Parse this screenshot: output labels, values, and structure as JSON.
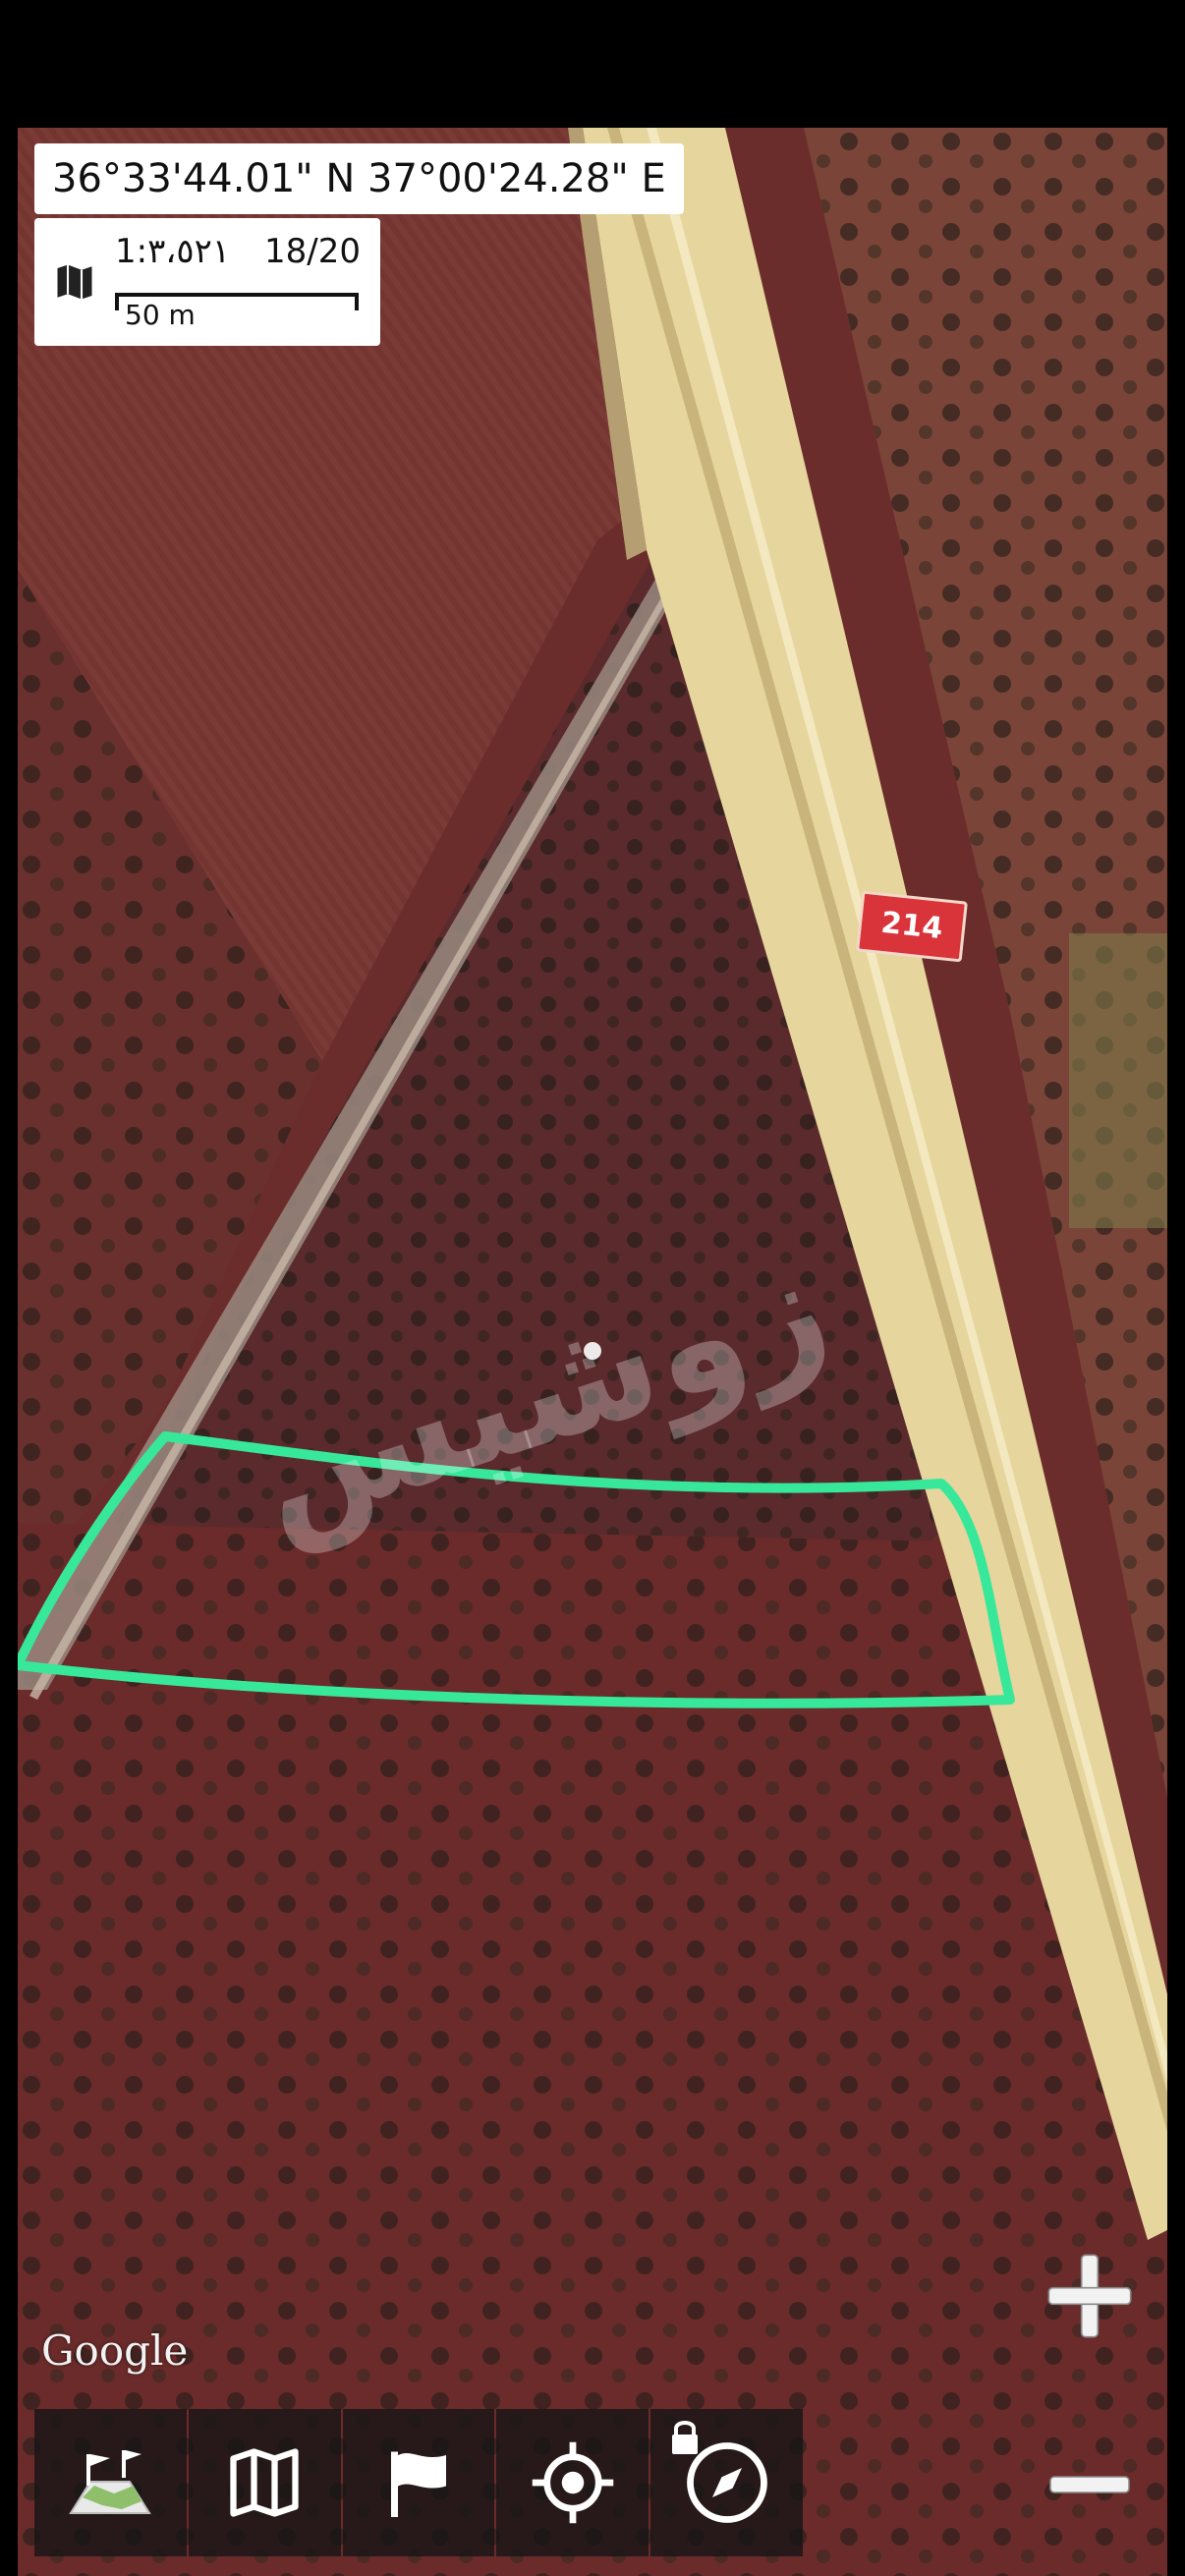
{
  "coordinates": {
    "text": "36°33'44.01\" N 37°00'24.28\" E"
  },
  "scale": {
    "ratio": "1:٣،٥٢١",
    "zoom_level": "18/20",
    "bar_label": "50 m"
  },
  "map": {
    "type": "satellite",
    "road_sign": "214",
    "watermark": "زوشيس",
    "attribution": "Google",
    "highlight_color": "#37e89a",
    "road_color": "#e8d8a0",
    "field_color": "#6e2c2a"
  },
  "toolbar": {
    "items": [
      {
        "icon": "map-layers-icon"
      },
      {
        "icon": "map-icon"
      },
      {
        "icon": "flag-icon"
      },
      {
        "icon": "locate-icon"
      },
      {
        "icon": "compass-icon",
        "locked": true
      }
    ]
  },
  "zoom_controls": {
    "plus": "+",
    "minus": "−"
  }
}
